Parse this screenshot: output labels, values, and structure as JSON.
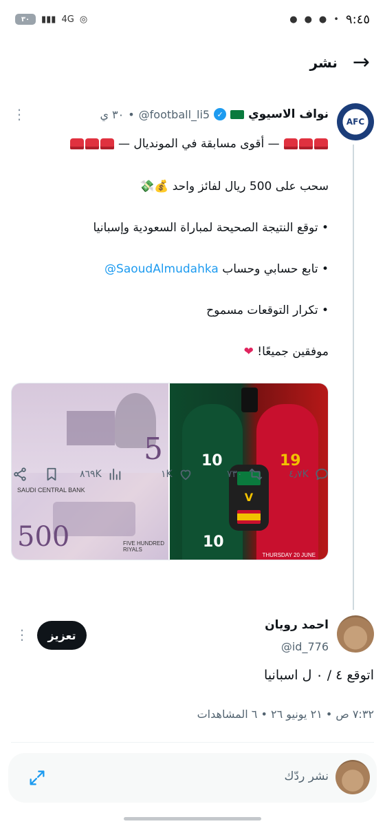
{
  "status_bar": {
    "time": "٩:٤٥",
    "battery": "٣٠",
    "network": "4G"
  },
  "header": {
    "title": "نشر",
    "back_icon": "arrow-right-icon"
  },
  "tweet": {
    "author_name": "نواف الاسيوي",
    "handle": "@football_li5",
    "time": "٣٠ ي",
    "dot": "•",
    "avatar_text": "AFC",
    "lines": {
      "headline": "— أقوى مسابقة في المونديال —",
      "prize": "سحب على 500 ريال لفائز واحد",
      "rule1": "• توقع النتيجة الصحيحة لمباراة السعودية وإسبانيا",
      "rule2_prefix": "• تابع حسابي وحساب ",
      "rule2_link": "SaoudAlmudahka@",
      "rule3": "• تكرار التوقعات مسموح",
      "closing": "موفقين جميعًا! ",
      "heart": "❤"
    },
    "media": {
      "banknote": {
        "bank": "SAUDI CENTRAL BANK",
        "five": "5",
        "five_hundred": "500",
        "bottom_text": "FIVE HUNDRED\nRIYALS"
      },
      "match": {
        "left_number": "10",
        "left_number_bottom": "10",
        "right_number": "19",
        "vs": "V",
        "date": "THURSDAY 20 JUNE"
      }
    },
    "stats": {
      "replies": "٤٫٧K",
      "retweets": "٧٣٠",
      "likes": "١K",
      "views": "٨٦٩K"
    }
  },
  "reply": {
    "author_name": "احمد رويان",
    "handle": "@id_776",
    "follow_label": "تعزيز",
    "text": "اتوقع ٤ / ٠ ل اسبانيا"
  },
  "meta": {
    "text": "٧:٣٢ ص • ٢١ يونيو ٢٦ • ٦ المشاهدات"
  },
  "composer": {
    "placeholder": "نشر ردّك"
  },
  "colors": {
    "link": "#1d9bf0",
    "muted": "#536471",
    "follow_button": "#0f1419"
  }
}
